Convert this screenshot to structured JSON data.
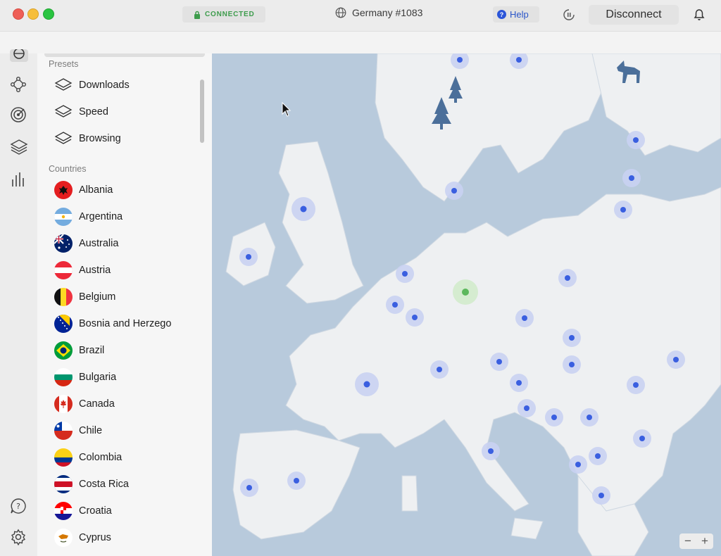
{
  "window": {
    "status_label": "CONNECTED",
    "server_name": "Germany #1083",
    "help_label": "Help",
    "disconnect_label": "Disconnect"
  },
  "rail": {
    "icons": [
      "globe-icon",
      "meshnet-icon",
      "target-icon",
      "layers-icon",
      "stats-icon",
      "support-icon",
      "settings-icon"
    ]
  },
  "sidebar": {
    "presets_title": "Presets",
    "presets": [
      {
        "label": "Downloads"
      },
      {
        "label": "Speed"
      },
      {
        "label": "Browsing"
      }
    ],
    "countries_title": "Countries",
    "countries": [
      {
        "label": "Albania"
      },
      {
        "label": "Argentina"
      },
      {
        "label": "Australia"
      },
      {
        "label": "Austria"
      },
      {
        "label": "Belgium"
      },
      {
        "label": "Bosnia and Herzego"
      },
      {
        "label": "Brazil"
      },
      {
        "label": "Bulgaria"
      },
      {
        "label": "Canada"
      },
      {
        "label": "Chile"
      },
      {
        "label": "Colombia"
      },
      {
        "label": "Costa Rica"
      },
      {
        "label": "Croatia"
      },
      {
        "label": "Cyprus"
      }
    ]
  },
  "map": {
    "active_country": "Germany",
    "zoom_out_label": "−",
    "zoom_in_label": "+"
  },
  "colors": {
    "connected_green": "#3d9c4c",
    "pin_blue": "#3a5fe0",
    "sea": "#b8cadc",
    "land": "#eef0f2"
  }
}
